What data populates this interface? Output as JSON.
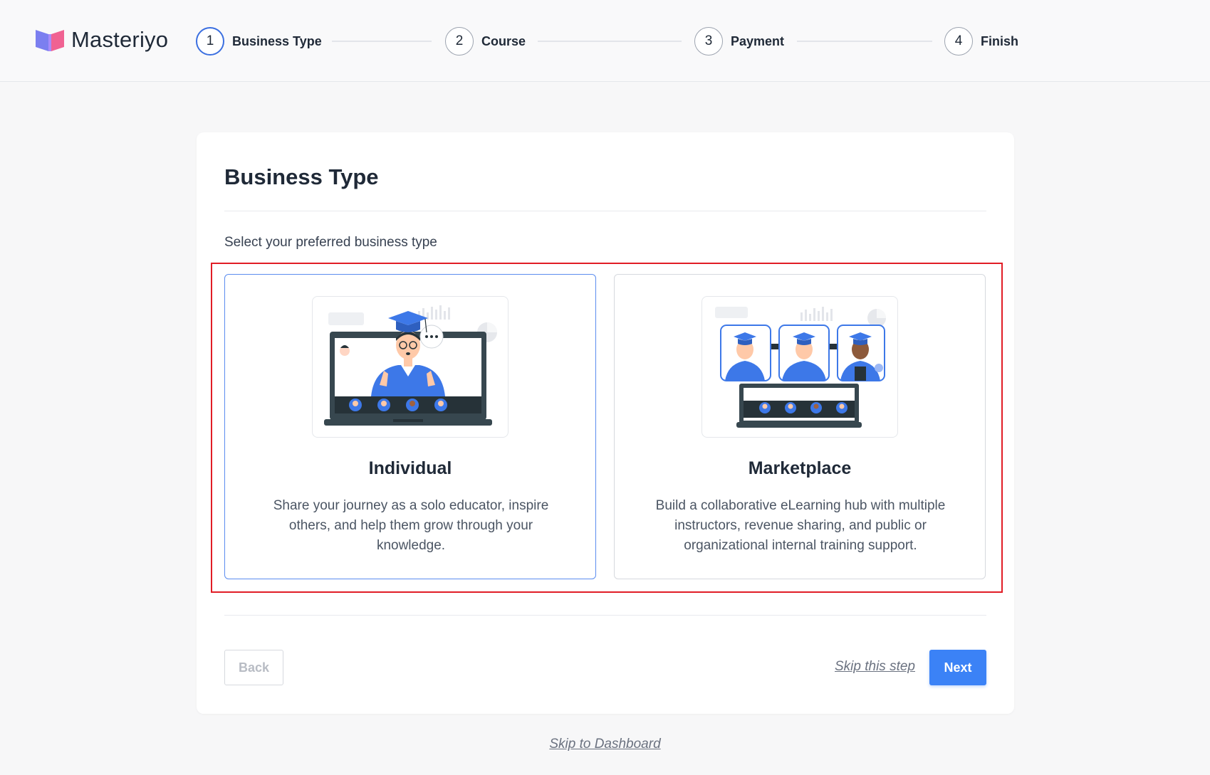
{
  "brand": {
    "name": "Masteriyo"
  },
  "steps": [
    {
      "number": "1",
      "label": "Business Type",
      "active": true
    },
    {
      "number": "2",
      "label": "Course",
      "active": false
    },
    {
      "number": "3",
      "label": "Payment",
      "active": false
    },
    {
      "number": "4",
      "label": "Finish",
      "active": false
    }
  ],
  "card": {
    "title": "Business Type",
    "subtitle": "Select your preferred business type"
  },
  "options": [
    {
      "title": "Individual",
      "description": "Share your journey as a solo educator, inspire others, and help them grow through your knowledge.",
      "selected": true,
      "illustration": "individual-teacher-laptop-illustration"
    },
    {
      "title": "Marketplace",
      "description": "Build a collaborative eLearning hub with multiple instructors, revenue sharing, and public or organizational internal training support.",
      "selected": false,
      "illustration": "marketplace-instructors-illustration"
    }
  ],
  "actions": {
    "back_label": "Back",
    "skip_step_label": "Skip this step",
    "next_label": "Next",
    "skip_dashboard_label": "Skip to Dashboard"
  },
  "colors": {
    "accent": "#3b82f6",
    "highlight": "#e11d26",
    "logo_purple": "#7b7ff0",
    "logo_pink": "#f06292"
  }
}
